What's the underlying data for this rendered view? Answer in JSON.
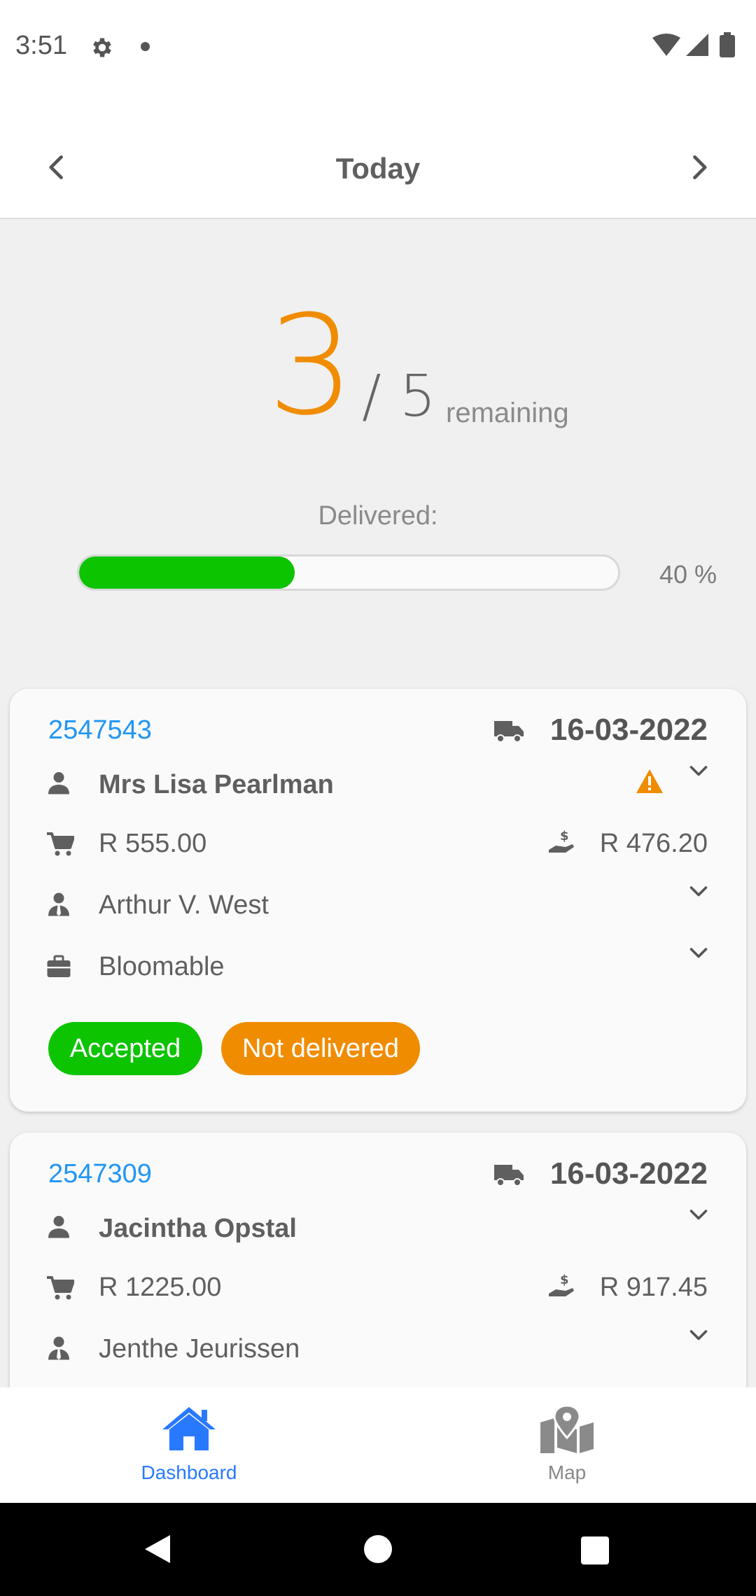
{
  "status_bar": {
    "time": "3:51"
  },
  "top_nav": {
    "title": "Today"
  },
  "summary": {
    "remaining_count": "3",
    "total": "/ 5",
    "remaining_label": "remaining",
    "delivered_label": "Delivered:",
    "progress_fraction": 0.4,
    "progress_text": "40 %"
  },
  "orders": [
    {
      "order_number": "2547543",
      "date": "16-03-2022",
      "customer": "Mrs Lisa Pearlman",
      "order_total": "R 555.00",
      "payment_amount": "R 476.20",
      "driver": "Arthur V. West",
      "company": "Bloomable",
      "badges": [
        "Accepted",
        "Not delivered"
      ],
      "warning": true
    },
    {
      "order_number": "2547309",
      "date": "16-03-2022",
      "customer": "Jacintha Opstal",
      "order_total": "R 1225.00",
      "payment_amount": "R 917.45",
      "driver": "Jenthe Jeurissen"
    }
  ],
  "bottom_nav": {
    "items": [
      {
        "label": "Dashboard",
        "icon": "home-icon",
        "active": true
      },
      {
        "label": "Map",
        "icon": "map-marker-icon",
        "active": false
      }
    ]
  },
  "colors": {
    "accent_orange": "#f08c00",
    "success_green": "#0cc400",
    "link_blue": "#2196f3",
    "active_nav_blue": "#2979ff"
  }
}
